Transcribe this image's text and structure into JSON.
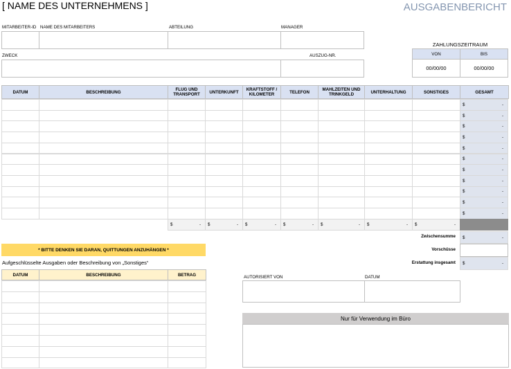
{
  "header": {
    "company": "[ NAME DES UNTERNEHMENS ]",
    "title": "AUSGABENBERICHT"
  },
  "fields": {
    "employee_id": "MITARBEITER-ID",
    "employee_name": "NAME DES MITARBEITERS",
    "department": "ABTEILUNG",
    "manager": "MANAGER",
    "purpose": "ZWECK",
    "statement_no": "AUSZUG-NR."
  },
  "period": {
    "title": "ZAHLUNGSZEITRAUM",
    "from_label": "VON",
    "to_label": "BIS",
    "from_value": "00/00/00",
    "to_value": "00/00/00"
  },
  "table": {
    "columns": [
      "DATUM",
      "BESCHREIBUNG",
      "FLUG UND TRANSPORT",
      "UNTERKUNFT",
      "KRAFTSTOFF / KILOMETER",
      "TELEFON",
      "MAHLZEITEN UND TRINKGELD",
      "UNTERHALTUNG",
      "SONSTIGES",
      "GESAMT"
    ],
    "row_count": 11,
    "currency": "$",
    "dash": "-"
  },
  "summary": {
    "subtotal": "Zwischensumme",
    "advances": "Vorschüsse",
    "refund": "Erstattung insgesamt"
  },
  "reminder": "* BITTE DENKEN SIE DARAN, QUITTUNGEN ANZUHÄNGEN *",
  "misc": {
    "title": "Aufgeschlüsselte Ausgaben oder Beschreibung von „Sonstiges“",
    "columns": [
      "DATUM",
      "BESCHREIBUNG",
      "BETRAG"
    ],
    "row_count": 8
  },
  "auth": {
    "authorized_by": "AUTORISIERT VON",
    "date": "DATUM"
  },
  "office": "Nur für Verwendung im Büro"
}
